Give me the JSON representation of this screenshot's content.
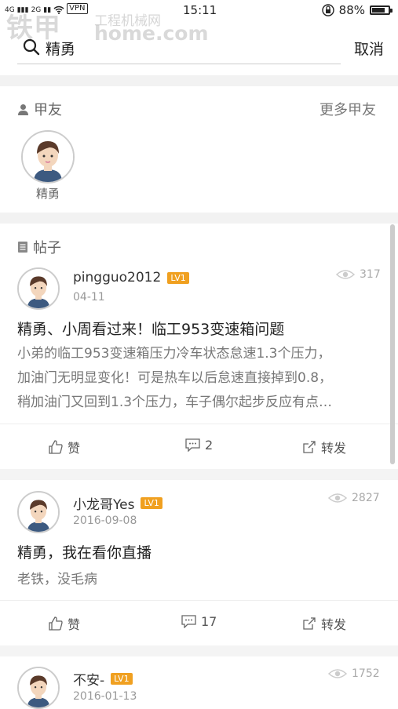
{
  "status_bar": {
    "net1": "4G",
    "net2": "2G",
    "vpn": "VPN",
    "time": "15:11",
    "battery": "88%",
    "battery_level": 0.88
  },
  "watermark": {
    "logo": "铁甲",
    "tagline": "工程机械网",
    "url": "home.com"
  },
  "search": {
    "value": "精勇",
    "cancel_label": "取消"
  },
  "friends_section": {
    "title": "甲友",
    "more_label": "更多甲友",
    "friends": [
      {
        "name": "精勇"
      }
    ]
  },
  "posts_section": {
    "title": "帖子",
    "posts": [
      {
        "username": "pingguo2012",
        "level": "LV1",
        "date": "04-11",
        "views": "317",
        "title": "精勇、小周看过来！临工953变速箱问题",
        "body": [
          "小弟的临工953变速箱压力冷车状态怠速1.3个压力，",
          "加油门无明显变化！可是热车以后怠速直接掉到0.8，",
          "稍加油门又回到1.3个压力，车子偶尔起步反应有点…"
        ],
        "like_label": "赞",
        "comments": "2",
        "share_label": "转发"
      },
      {
        "username": "小龙哥Yes",
        "level": "LV1",
        "date": "2016-09-08",
        "views": "2827",
        "title": "精勇，我在看你直播",
        "body": [
          "老铁，没毛病"
        ],
        "like_label": "赞",
        "comments": "17",
        "share_label": "转发"
      },
      {
        "username": "不安-",
        "level": "LV1",
        "date": "2016-01-13",
        "views": "1752"
      }
    ]
  },
  "colors": {
    "level_badge": "#f0a020",
    "divider": "#f2f2f2",
    "avatar_shirt": "#3d5a80",
    "avatar_hair": "#5a3a2a"
  }
}
